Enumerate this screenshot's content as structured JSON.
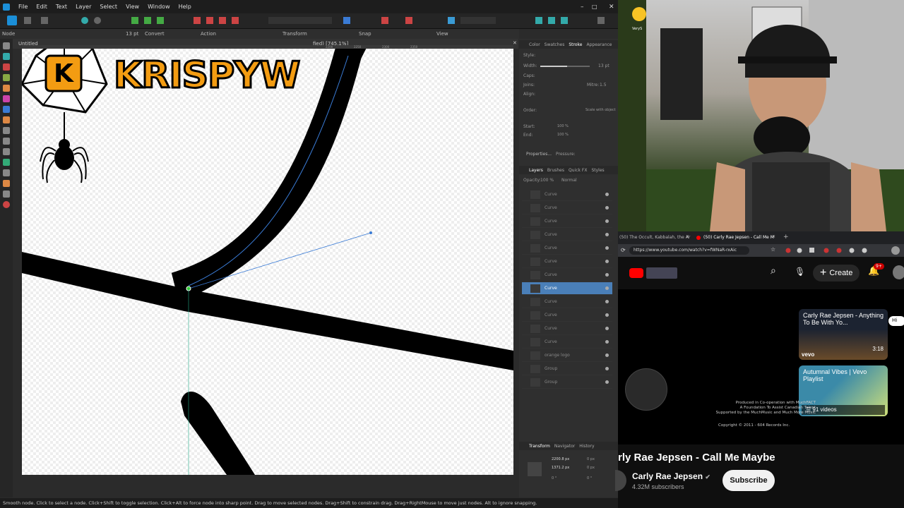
{
  "menu": [
    "File",
    "Edit",
    "Text",
    "Layer",
    "Select",
    "View",
    "Window",
    "Help"
  ],
  "context": {
    "node": "Node",
    "width": "13 pt",
    "convert": "Convert",
    "action": "Action",
    "transform": "Transform",
    "snap": "Snap",
    "view": "View"
  },
  "doc_tab": "Untitled",
  "doc_zoom": "fied) [745.1%]",
  "ruler": [
    "2200",
    "2250",
    "2300",
    "2350"
  ],
  "overlay": {
    "title": "KRISPYW",
    "badge": "K"
  },
  "panel_tabs": [
    "Color",
    "Swatches",
    "Stroke",
    "Appearance"
  ],
  "stroke": {
    "style": "Style:",
    "width": "Width:",
    "width_val": "13 pt",
    "caps": "Caps:",
    "joins": "Joins:",
    "mitre": "Mitre:",
    "mitre_val": "1.5",
    "align": "Align:",
    "order": "Order:",
    "scale": "Scale with object",
    "start": "Start:",
    "end": "End:",
    "pct": "100 %",
    "properties": "Properties...",
    "pressure": "Pressure:"
  },
  "layers_tabs": [
    "Layers",
    "Brushes",
    "Quick FX",
    "Styles"
  ],
  "layers_opts": {
    "opacity": "Opacity:",
    "opacity_val": "100 %",
    "blend": "Normal"
  },
  "layers": [
    "Curve",
    "Curve",
    "Curve",
    "Curve",
    "Curve",
    "Curve",
    "Curve",
    "Curve",
    "Curve",
    "Curve",
    "Curve",
    "Curve",
    "orange logo",
    "Group",
    "Group"
  ],
  "selected_layer": 7,
  "transform_tabs": [
    "Transform",
    "Navigator",
    "History"
  ],
  "transform": {
    "x": "2200.8 px",
    "y": "1371.2 px",
    "w": "0 px",
    "h": "0 px",
    "r": "0 °",
    "s": "0 °"
  },
  "status": "Smooth node. Click to select a node. Click+Shift to toggle selection. Click+Alt to force node into sharp point. Drag to move selected nodes. Drag+Shift to constrain drag. Drag+RightMouse to move just nodes. Alt to ignore snapping.",
  "browser": {
    "tab1": "(50) The Occult, Kabbalah, the Ar",
    "tab2": "(50) Carly Rae Jepsen - Call Me M",
    "url": "https://www.youtube.com/watch?v=fWNaR-rxAic",
    "create": "Create",
    "notif": "9+"
  },
  "yt": {
    "card1_title": "Carly Rae Jepsen - Anything To Be With Yo...",
    "card1_time": "3:18",
    "card1_brand": "vevo",
    "card2_title": "Autumnal Vibes | Vevo Playlist",
    "card2_count": "91 videos",
    "credits1": "Produced in Co-operation with MuchFACT",
    "credits2": "A Foundation To Assist Canadian Talent",
    "credits3": "Supported by the MuchMusic and Much More Music",
    "copyright": "Copyright © 2011 - 604 Records Inc.",
    "hide": "Hi",
    "video_title": "rly Rae Jepsen - Call Me Maybe",
    "channel": "Carly Rae Jepsen",
    "subs": "4.32M subscribers",
    "subscribe": "Subscribe"
  },
  "cam_label": "VeryS",
  "colors": {
    "selected_layer": "#4a7fb8",
    "yt_red": "#ff0000",
    "logo_orange": "#f39c12"
  }
}
